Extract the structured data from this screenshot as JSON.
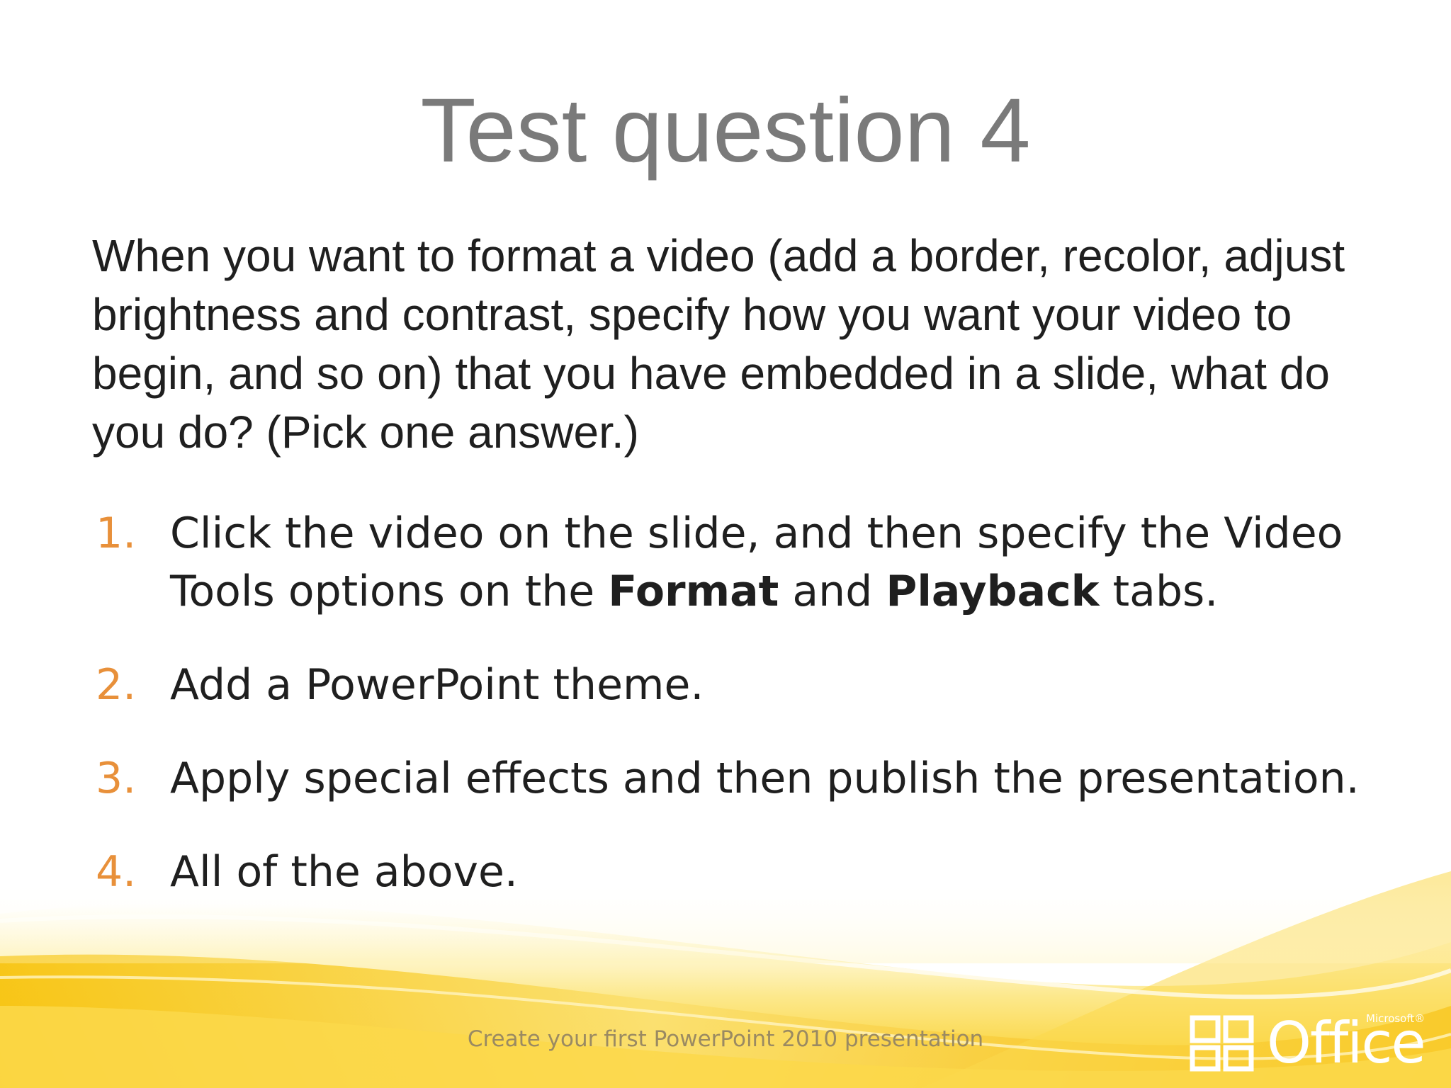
{
  "slide": {
    "title": "Test question 4",
    "question": "When you want to format a video (add a border, recolor, adjust brightness and contrast, specify how you want your video to begin, and so on) that you have embedded in a slide, what do you do? (Pick one answer.)",
    "answers": [
      {
        "number": "1.",
        "text_a": "Click the video on the slide, and then specify the Video Tools options on the ",
        "bold_a": "Format",
        "text_b": " and ",
        "bold_b": "Playback",
        "text_c": " tabs."
      },
      {
        "number": "2.",
        "text": "Add a PowerPoint theme."
      },
      {
        "number": "3.",
        "text": "Apply special effects and then publish the presentation."
      },
      {
        "number": "4.",
        "text": "All of the above."
      }
    ],
    "footer": "Create your first PowerPoint 2010 presentation"
  },
  "logo": {
    "word": "Office",
    "superscript": "Microsoft®"
  },
  "colors": {
    "title": "#7a7a7a",
    "body": "#1f1f1f",
    "accent_number": "#e8903a",
    "footer": "#9a8a62",
    "swoosh_yellow": "#f8d020"
  }
}
